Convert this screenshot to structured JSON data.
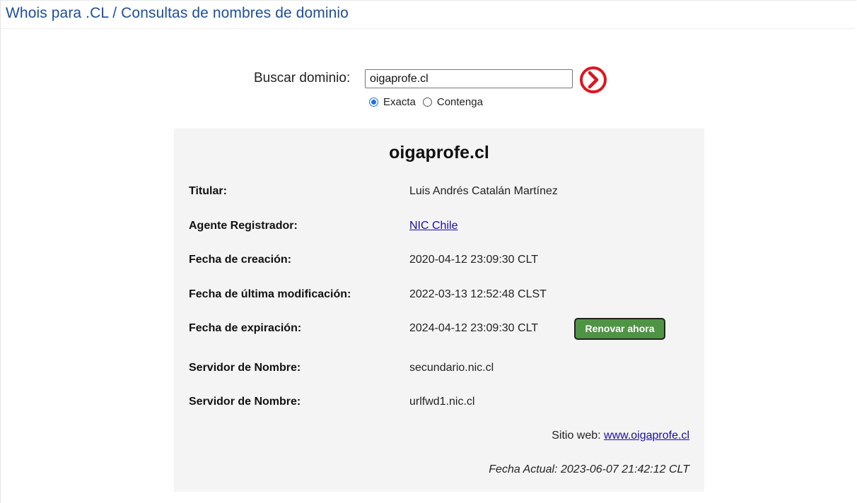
{
  "header": {
    "title": "Whois para .CL / Consultas de nombres de dominio"
  },
  "search": {
    "label": "Buscar dominio:",
    "value": "oigaprofe.cl",
    "options": [
      {
        "label": "Exacta",
        "checked": true
      },
      {
        "label": "Contenga",
        "checked": false
      }
    ],
    "submit_icon": "arrow-right-circle-icon",
    "submit_color": "#e0141e"
  },
  "result": {
    "domain": "oigaprofe.cl",
    "rows": [
      {
        "label": "Titular:",
        "value": "Luis Andrés Catalán Martínez"
      },
      {
        "label": "Agente Registrador:",
        "value": "NIC Chile"
      },
      {
        "label": "Fecha de creación:",
        "value": "2020-04-12 23:09:30 CLT"
      },
      {
        "label": "Fecha de última modificación:",
        "value": "2022-03-13 12:52:48 CLST"
      },
      {
        "label": "Fecha de expiración:",
        "value": "2024-04-12 23:09:30 CLT"
      },
      {
        "label": "Servidor de Nombre:",
        "value": "secundario.nic.cl"
      },
      {
        "label": "Servidor de Nombre:",
        "value": "urlfwd1.nic.cl"
      }
    ],
    "renew_label": "Renovar ahora",
    "renew_color": "#4e9444",
    "website_label": "Sitio web:",
    "website_link": "www.oigaprofe.cl",
    "current_date": "Fecha Actual: 2023-06-07 21:42:12 CLT"
  }
}
